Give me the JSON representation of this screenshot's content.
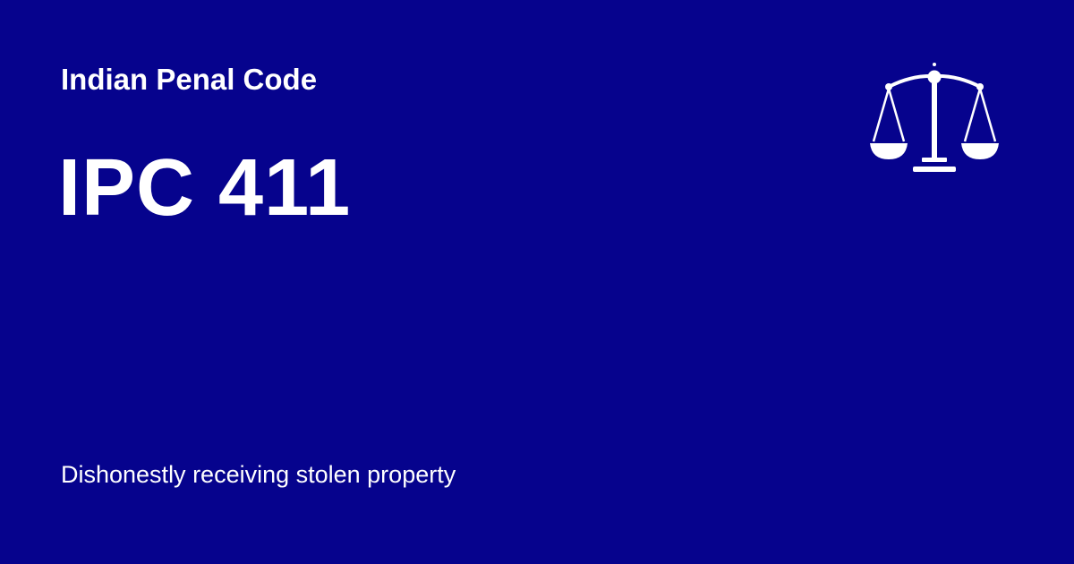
{
  "header": {
    "eyebrow": "Indian Penal Code"
  },
  "main": {
    "title": "IPC 411",
    "description": "Dishonestly receiving stolen property"
  },
  "icon": {
    "name": "scales-of-justice-icon"
  },
  "colors": {
    "background": "#06038d",
    "foreground": "#ffffff"
  }
}
